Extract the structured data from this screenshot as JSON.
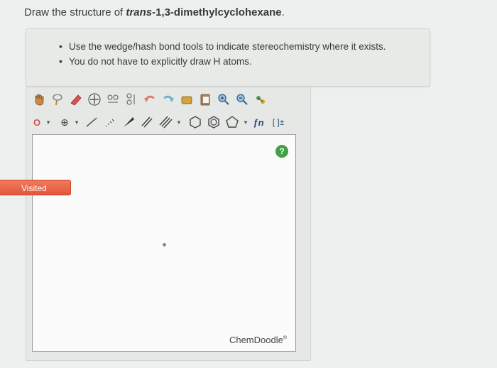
{
  "question": {
    "prefix": "Draw the structure of ",
    "compound_italic": "trans",
    "compound_rest": "-1,3-dimethylcyclohexane",
    "suffix": "."
  },
  "instructions": [
    "Use the wedge/hash bond tools to indicate stereochemistry where it exists.",
    "You do not have to explicitly draw H atoms."
  ],
  "toolbar": {
    "element_label": "O",
    "charge_label": "⊕",
    "arrow_glyph": "▾",
    "brackets_label": "[ ]±",
    "fn_label": "ƒn"
  },
  "editor": {
    "help_label": "?",
    "brand": "ChemDoodle",
    "brand_mark": "®"
  },
  "visited_badge": "Visited",
  "colors": {
    "help_green": "#43a047",
    "visited_red": "#e2573a"
  }
}
